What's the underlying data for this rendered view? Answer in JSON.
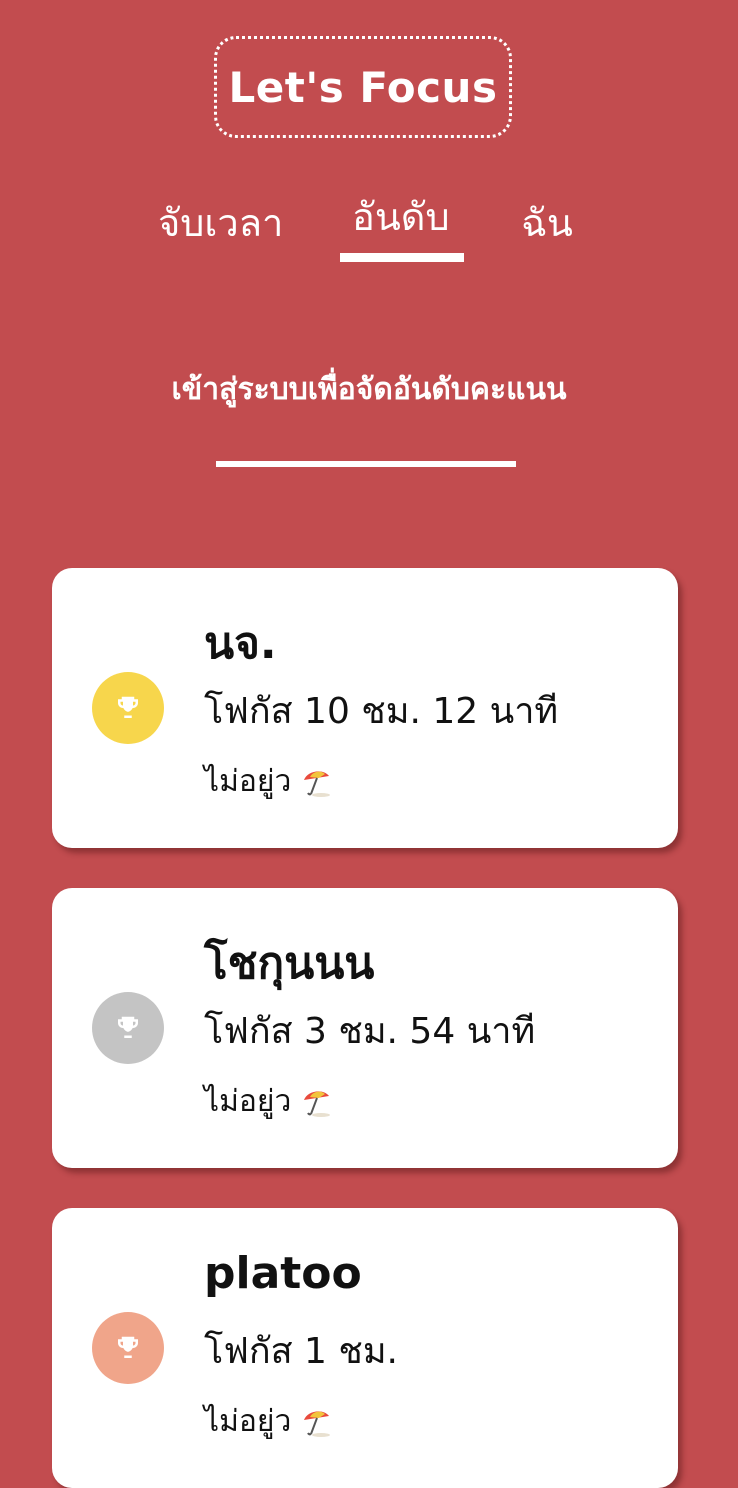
{
  "app": {
    "title": "Let's Focus"
  },
  "tabs": [
    {
      "label": "จับเวลา",
      "active": false
    },
    {
      "label": "อันดับ",
      "active": true
    },
    {
      "label": "ฉัน",
      "active": false
    }
  ],
  "login_prompt": "เข้าสู่ระบบเพื่อจัดอันดับคะแนน",
  "leaderboard": [
    {
      "name": "นจ.",
      "focus": "โฟกัส 10 ชม. 12 นาที",
      "status": "ไม่อยู่ว",
      "rank_color": "#f7d64c",
      "icon": "trophy-icon"
    },
    {
      "name": "โชกุนนน",
      "focus": "โฟกัส 3 ชม. 54 นาที",
      "status": "ไม่อยู่ว",
      "rank_color": "#c4c4c4",
      "icon": "trophy-icon"
    },
    {
      "name": "platoo",
      "focus": "โฟกัส 1 ชม.",
      "status": "ไม่อยู่ว",
      "rank_color": "#f0a58a",
      "icon": "trophy-icon"
    }
  ],
  "colors": {
    "background": "#c24c4f",
    "card": "#ffffff",
    "gold": "#f7d64c",
    "silver": "#c4c4c4",
    "bronze": "#f0a58a"
  }
}
